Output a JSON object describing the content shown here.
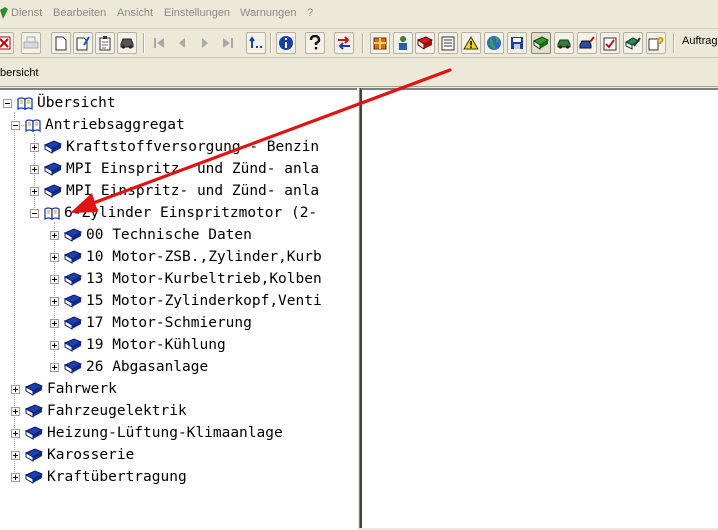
{
  "menubar": {
    "items": [
      "Dienst",
      "Bearbeiten",
      "Ansicht",
      "Einstellungen",
      "Warnungen",
      "?"
    ]
  },
  "toolbar": {
    "buttons": [
      "exit-icon",
      "print-icon",
      "new-document-icon",
      "edit-document-icon",
      "notepad-icon",
      "car-icon",
      "first-icon",
      "previous-icon",
      "next-icon",
      "last-icon",
      "up-level-icon",
      "info-icon",
      "help-icon",
      "sync-icon",
      "package-icon",
      "person-icon",
      "red-book-icon",
      "list-icon",
      "warning-icon",
      "globe-icon",
      "save-icon",
      "green-book-icon",
      "green-car-icon",
      "wrench-car-icon",
      "checklist-icon",
      "pencil-book-icon",
      "help-book-icon"
    ],
    "auftrag_label": "Auftrag"
  },
  "tabstrip": {
    "label": "bersicht"
  },
  "tree": {
    "root": "Übersicht",
    "antrieb": "Antriebsaggregat",
    "antrieb_children": [
      "Kraftstoffversorgung - Benzin",
      "MPI Einspritz- und Zünd- anla",
      "MPI Einspritz- und Zünd- anla",
      "6-Zylinder Einspritzmotor (2-"
    ],
    "motor_children": [
      "00 Technische Daten",
      "10 Motor-ZSB.,Zylinder,Kurb",
      "13 Motor-Kurbeltrieb,Kolben",
      "15 Motor-Zylinderkopf,Venti",
      "17 Motor-Schmierung",
      "19 Motor-Kühlung",
      "26 Abgasanlage"
    ],
    "top_level": [
      "Fahrwerk",
      "Fahrzeugelektrik",
      "Heizung-Lüftung-Klimaanlage",
      "Karosserie",
      "Kraftübertragung"
    ]
  },
  "colors": {
    "arrow": "#e01414",
    "menu_disabled": "#8a8a8a",
    "book_blue": "#1f3fb0"
  }
}
